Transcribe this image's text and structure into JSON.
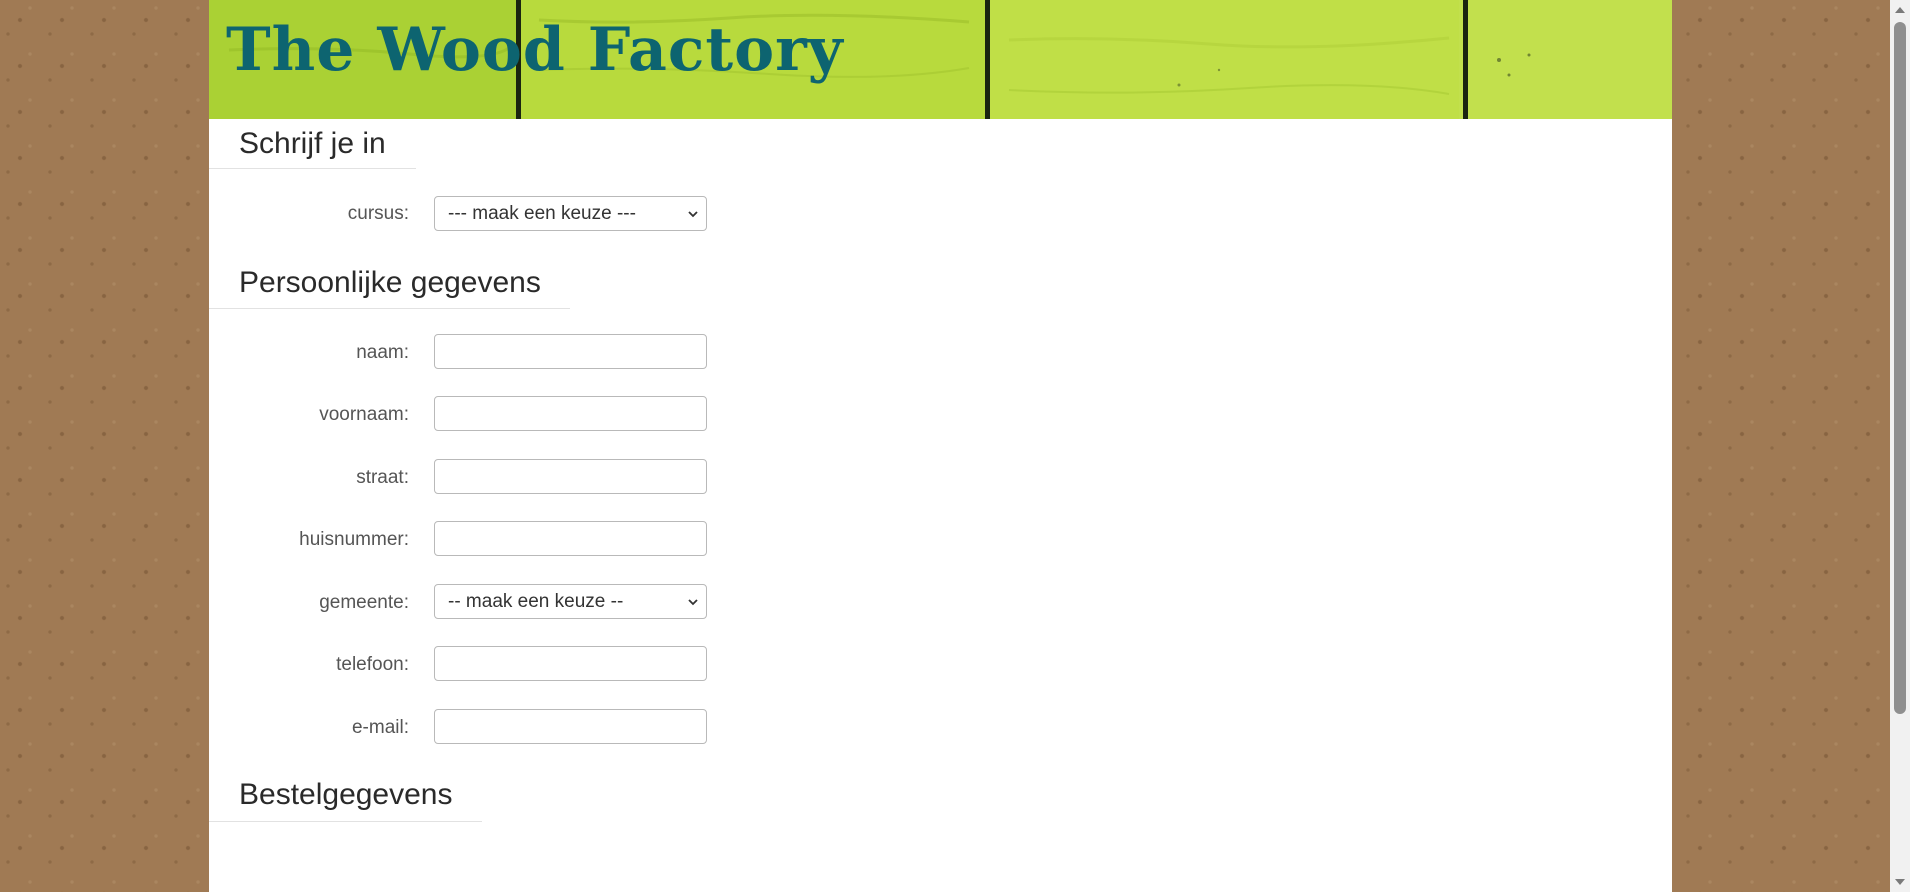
{
  "site": {
    "title": "The Wood Factory"
  },
  "sections": {
    "enroll": "Schrijf je in",
    "personal": "Persoonlijke gegevens",
    "order": "Bestelgegevens"
  },
  "course": {
    "label": "cursus:",
    "selected": "--- maak een keuze ---"
  },
  "fields": {
    "naam": {
      "label": "naam:",
      "value": ""
    },
    "voornaam": {
      "label": "voornaam:",
      "value": ""
    },
    "straat": {
      "label": "straat:",
      "value": ""
    },
    "huisnummer": {
      "label": "huisnummer:",
      "value": ""
    },
    "gemeente": {
      "label": "gemeente:",
      "selected": "-- maak een keuze --"
    },
    "telefoon": {
      "label": "telefoon:",
      "value": ""
    },
    "email": {
      "label": "e-mail:",
      "value": ""
    }
  },
  "colors": {
    "background": "#a07a54",
    "banner_green": "#b6d93b",
    "title_teal": "#0d6470",
    "heading_text": "#2a2a2a",
    "label_text": "#555555"
  },
  "icons": {
    "select_arrow": "chevron-down-icon",
    "scroll_up": "arrow-up-icon",
    "scroll_down": "arrow-down-icon"
  }
}
